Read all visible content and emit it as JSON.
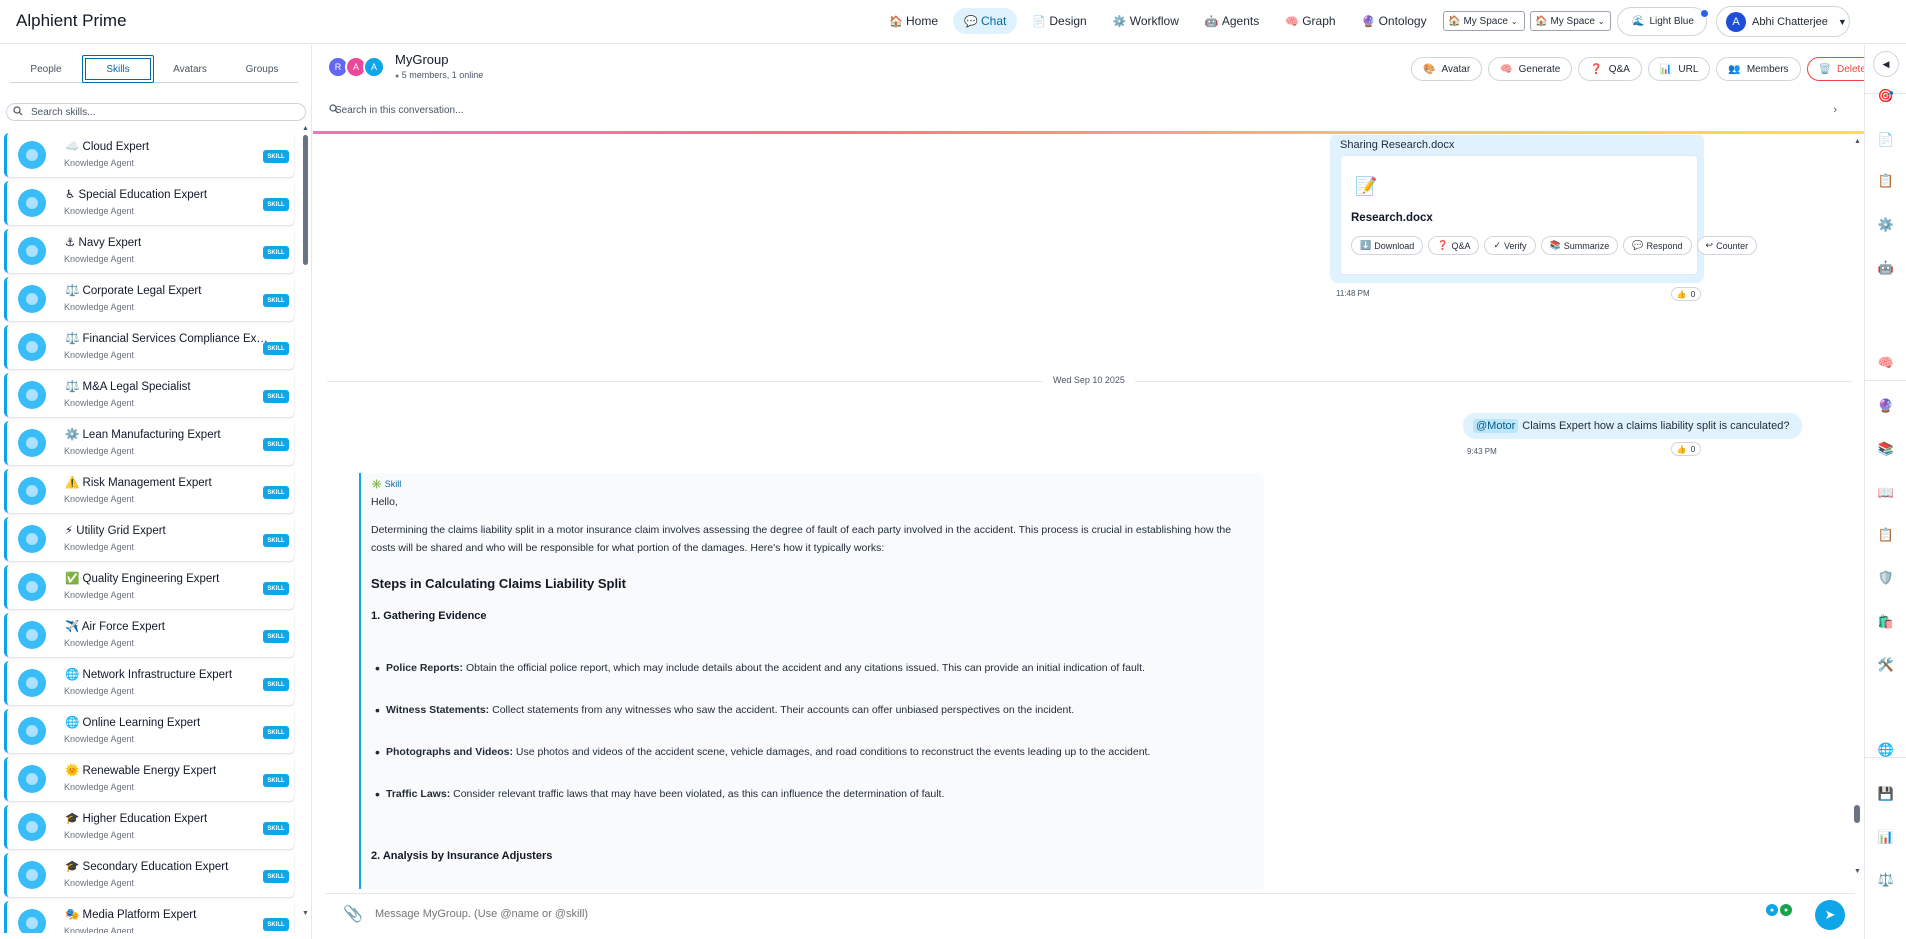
{
  "app": {
    "title": "Alphient Prime"
  },
  "nav": [
    {
      "label": "Home",
      "icon": "🏠",
      "active": false
    },
    {
      "label": "Chat",
      "icon": "💬",
      "active": true
    },
    {
      "label": "Design",
      "icon": "📄",
      "active": false
    },
    {
      "label": "Workflow",
      "icon": "⚙️",
      "active": false
    },
    {
      "label": "Agents",
      "icon": "🤖",
      "active": false
    },
    {
      "label": "Graph",
      "icon": "🧠",
      "active": false
    },
    {
      "label": "Ontology",
      "icon": "🔮",
      "active": false
    }
  ],
  "spaces": [
    {
      "icon": "🏠",
      "value": "My Space"
    },
    {
      "icon": "🏠",
      "value": "My Space"
    }
  ],
  "theme": {
    "label": "Light Blue",
    "icon": "🌊"
  },
  "user": {
    "initial": "A",
    "name": "Abhi Chatterjee",
    "caret": "▼"
  },
  "sidebar": {
    "tabs": [
      "People",
      "Skills",
      "Avatars",
      "Groups"
    ],
    "active_tab": "Skills",
    "search_placeholder": "Search skills...",
    "badge": "SKILL",
    "skills": [
      {
        "emoji": "☁️",
        "name": "Cloud Expert",
        "sub": "Knowledge Agent"
      },
      {
        "emoji": "♿",
        "name": "Special Education Expert",
        "sub": "Knowledge Agent"
      },
      {
        "emoji": "⚓",
        "name": "Navy Expert",
        "sub": "Knowledge Agent"
      },
      {
        "emoji": "⚖️",
        "name": "Corporate Legal Expert",
        "sub": "Knowledge Agent"
      },
      {
        "emoji": "⚖️",
        "name": "Financial Services Compliance Exp...",
        "sub": "Knowledge Agent"
      },
      {
        "emoji": "⚖️",
        "name": "M&A Legal Specialist",
        "sub": "Knowledge Agent"
      },
      {
        "emoji": "⚙️",
        "name": "Lean Manufacturing Expert",
        "sub": "Knowledge Agent"
      },
      {
        "emoji": "⚠️",
        "name": "Risk Management Expert",
        "sub": "Knowledge Agent"
      },
      {
        "emoji": "⚡",
        "name": "Utility Grid Expert",
        "sub": "Knowledge Agent"
      },
      {
        "emoji": "✅",
        "name": "Quality Engineering Expert",
        "sub": "Knowledge Agent"
      },
      {
        "emoji": "✈️",
        "name": "Air Force Expert",
        "sub": "Knowledge Agent"
      },
      {
        "emoji": "🌐",
        "name": "Network Infrastructure Expert",
        "sub": "Knowledge Agent"
      },
      {
        "emoji": "🌐",
        "name": "Online Learning Expert",
        "sub": "Knowledge Agent"
      },
      {
        "emoji": "🌞",
        "name": "Renewable Energy Expert",
        "sub": "Knowledge Agent"
      },
      {
        "emoji": "🎓",
        "name": "Higher Education Expert",
        "sub": "Knowledge Agent"
      },
      {
        "emoji": "🎓",
        "name": "Secondary Education Expert",
        "sub": "Knowledge Agent"
      },
      {
        "emoji": "🎭",
        "name": "Media Platform Expert",
        "sub": "Knowledge Agent"
      }
    ]
  },
  "chat": {
    "group_initials": [
      "R",
      "A",
      "A"
    ],
    "group_colors": [
      "#6366f1",
      "#ec4899",
      "#0ea5e9"
    ],
    "group_name": "MyGroup",
    "members_text": "5 members, 1 online",
    "online_dot": "●",
    "actions": [
      {
        "label": "Avatar",
        "icon": "🎨"
      },
      {
        "label": "Generate",
        "icon": "🧠"
      },
      {
        "label": "Q&A",
        "icon": "❓"
      },
      {
        "label": "URL",
        "icon": "📊"
      },
      {
        "label": "Members",
        "icon": "👥"
      },
      {
        "label": "Delete",
        "icon": "🗑️",
        "danger": true
      }
    ],
    "search_placeholder": "Search in this conversation...",
    "file_message": {
      "title": "Sharing Research.docx",
      "file_icon": "📝",
      "file_name": "Research.docx",
      "actions": [
        {
          "icon": "⬇️",
          "label": "Download"
        },
        {
          "icon": "❓",
          "label": "Q&A"
        },
        {
          "icon": "✓",
          "label": "Verify"
        },
        {
          "icon": "📚",
          "label": "Summarize"
        },
        {
          "icon": "💬",
          "label": "Respond"
        },
        {
          "icon": "↩",
          "label": "Counter"
        }
      ],
      "time": "11:48 PM",
      "reaction": {
        "icon": "👍",
        "count": "0"
      }
    },
    "date_separator": "Wed Sep 10 2025",
    "user_message": {
      "mention": "@Motor",
      "text": "Claims Expert how a claims liability split is canculated?",
      "time": "9:43 PM",
      "reaction": {
        "icon": "👍",
        "count": "0"
      }
    },
    "bot_message": {
      "tag": "Skill",
      "tag_icon": "✳️",
      "greeting": "Hello,",
      "intro": "Determining the claims liability split in a motor insurance claim involves assessing the degree of fault of each party involved in the accident. This process is crucial in establishing how the costs will be shared and who will be responsible for what portion of the damages. Here's how it typically works:",
      "heading": "Steps in Calculating Claims Liability Split",
      "section1": "1. Gathering Evidence",
      "bullets": [
        {
          "term": "Police Reports:",
          "text": "Obtain the official police report, which may include details about the accident and any citations issued. This can provide an initial indication of fault."
        },
        {
          "term": "Witness Statements:",
          "text": "Collect statements from any witnesses who saw the accident. Their accounts can offer unbiased perspectives on the incident."
        },
        {
          "term": "Photographs and Videos:",
          "text": "Use photos and videos of the accident scene, vehicle damages, and road conditions to reconstruct the events leading up to the accident."
        },
        {
          "term": "Traffic Laws:",
          "text": "Consider relevant traffic laws that may have been violated, as this can influence the determination of fault."
        }
      ],
      "section2": "2. Analysis by Insurance Adjusters"
    },
    "composer": {
      "placeholder": "Message MyGroup. (Use @name or @skill)",
      "attach_icon": "📎",
      "send_icon": "➤"
    }
  },
  "rail": {
    "toggle": "◀",
    "icons": [
      "🎯",
      "📄",
      "📋",
      "⚙️",
      "🤖",
      "🧠",
      "🔮",
      "📚",
      "📖",
      "📋",
      "🛡️",
      "🛍️",
      "🛠️",
      "🌐",
      "💾",
      "📊",
      "⚖️"
    ]
  }
}
